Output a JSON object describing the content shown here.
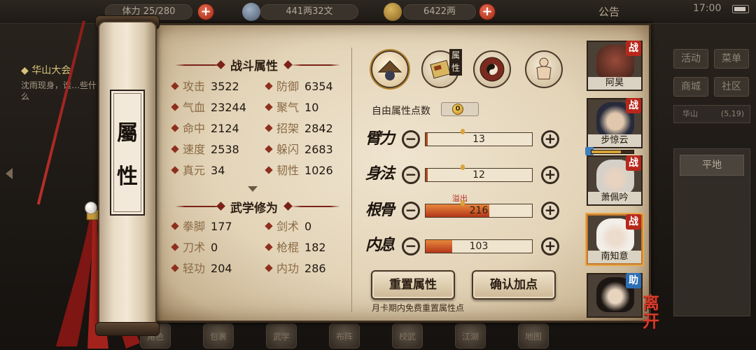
{
  "topbar": {
    "stamina_label": "体力",
    "stamina_value": "25/280",
    "silver": "441两32文",
    "gold": "6422两",
    "plus_label": "+",
    "announce": "公告",
    "clock": "17:00"
  },
  "left_panel": {
    "title": "华山大会",
    "desc": "沈雨现身，谁…些什么"
  },
  "right_menu": {
    "activity": "活动",
    "menu": "菜单",
    "shop": "商城",
    "community": "社区",
    "location": "华山",
    "location_coords": "(5,19)",
    "field": "平地"
  },
  "bottom_bar": [
    "角色",
    "包裹",
    "武学",
    "布阵",
    "校武",
    "江湖",
    "地图"
  ],
  "scroll": {
    "label_top": "屬",
    "label_bottom": "性"
  },
  "combat": {
    "title": "战斗属性",
    "stats": [
      {
        "label": "攻击",
        "value": "3522"
      },
      {
        "label": "防御",
        "value": "6354"
      },
      {
        "label": "气血",
        "value": "23244"
      },
      {
        "label": "聚气",
        "value": "10"
      },
      {
        "label": "命中",
        "value": "2124"
      },
      {
        "label": "招架",
        "value": "2842"
      },
      {
        "label": "速度",
        "value": "2538"
      },
      {
        "label": "躲闪",
        "value": "2683"
      },
      {
        "label": "真元",
        "value": "34"
      },
      {
        "label": "韧性",
        "value": "1026"
      }
    ]
  },
  "martial": {
    "title": "武学修为",
    "stats": [
      {
        "label": "拳脚",
        "value": "177"
      },
      {
        "label": "剑术",
        "value": "0"
      },
      {
        "label": "刀术",
        "value": "0"
      },
      {
        "label": "枪棍",
        "value": "182"
      },
      {
        "label": "轻功",
        "value": "204"
      },
      {
        "label": "内功",
        "value": "286"
      }
    ]
  },
  "tabs": {
    "attr_tag": "属性",
    "icons": [
      "hat-icon",
      "scroll-attr-icon",
      "bagua-icon",
      "body-icon"
    ]
  },
  "allocation": {
    "free_label": "自由属性点数",
    "free_value": "0",
    "overflow_label": "溢出",
    "attrs": [
      {
        "name": "臂力",
        "value": "13",
        "fill": 0.02
      },
      {
        "name": "身法",
        "value": "12",
        "fill": 0.02
      },
      {
        "name": "根骨",
        "value": "216",
        "fill": 0.6
      },
      {
        "name": "内息",
        "value": "103",
        "fill": 0.25
      }
    ],
    "minus": "−",
    "plus": "+"
  },
  "buttons": {
    "reset": "重置属性",
    "confirm": "确认加点",
    "note": "月卡期内免费重置属性点"
  },
  "roster": [
    {
      "name": "阿昊",
      "tag": "战",
      "tag_type": "war"
    },
    {
      "name": "步惊云",
      "tag": "战",
      "tag_type": "war"
    },
    {
      "name": "萧佩吟",
      "tag": "战",
      "tag_type": "war"
    },
    {
      "name": "南知意",
      "tag": "战",
      "tag_type": "war"
    },
    {
      "name": "",
      "tag": "助",
      "tag_type": "help"
    }
  ],
  "leave_label": "离开",
  "colors": {
    "accent_red": "#b8271b",
    "help_blue": "#2d6fb4",
    "bar_fill": "#b2361a",
    "paper": "#e3d4b8"
  }
}
